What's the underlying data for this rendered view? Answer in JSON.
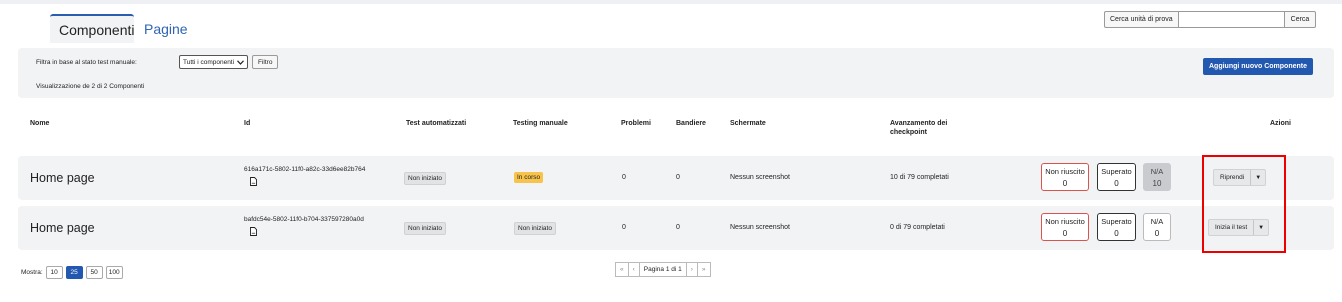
{
  "tabs": [
    {
      "label": "Componenti",
      "active": true
    },
    {
      "label": "Pagine",
      "active": false
    }
  ],
  "search": {
    "label": "Cerca unità di prova",
    "value": "",
    "button": "Cerca"
  },
  "filter": {
    "label": "Filtra in base al stato test manuale:",
    "select_value": "Tutti i componenti",
    "button": "Filtro",
    "showing": "Visualizzazione de 2 di 2 Componenti",
    "add_button": "Aggiungi nuovo Componente"
  },
  "columns": {
    "name": "Nome",
    "id": "Id",
    "auto": "Test automatizzati",
    "manual": "Testing manuale",
    "problems": "Problemi",
    "flags": "Bandiere",
    "screens": "Schermate",
    "progress": "Avanzamento dei checkpoint",
    "actions": "Azioni"
  },
  "rows": [
    {
      "name": "Home page",
      "id": "616a171c-5802-11f0-a82c-33d6ee82b764",
      "auto": "Non iniziato",
      "manual": "In corso",
      "problems": "0",
      "flags": "0",
      "screens": "Nessun screenshot",
      "progress": "10 di 79 completati",
      "fail_label": "Non riuscito",
      "fail_count": "0",
      "pass_label": "Superato",
      "pass_count": "0",
      "na_label": "N/A",
      "na_count": "10",
      "action": "Riprendi"
    },
    {
      "name": "Home page",
      "id": "bafdc54e-5802-11f0-b704-337597280a0d",
      "auto": "Non iniziato",
      "manual": "Non iniziato",
      "problems": "0",
      "flags": "0",
      "screens": "Nessun screenshot",
      "progress": "0 di 79 completati",
      "fail_label": "Non riuscito",
      "fail_count": "0",
      "pass_label": "Superato",
      "pass_count": "0",
      "na_label": "N/A",
      "na_count": "0",
      "action": "Inizia il test"
    }
  ],
  "footer": {
    "show_label": "Mostra:",
    "page_sizes": [
      "10",
      "25",
      "50",
      "100"
    ],
    "selected_size": "25",
    "first": "«",
    "prev": "‹",
    "page_label": "Pagina 1 di 1",
    "next": "›",
    "last": "»"
  },
  "icons": {
    "doc": "document-icon",
    "caret": "caret-down-icon"
  },
  "colors": {
    "accent": "#2358b0",
    "fail_border": "#d9534f",
    "in_progress": "#f7c34b",
    "highlight": "#ee0000"
  }
}
